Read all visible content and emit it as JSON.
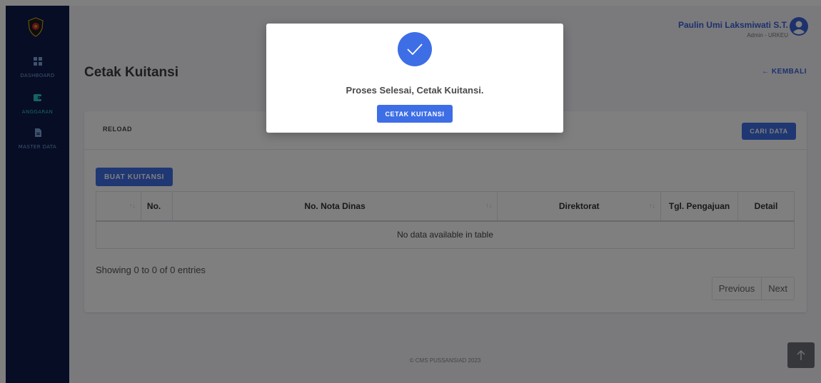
{
  "header": {
    "user_name": "Paulin Umi Laksmiwati S.T.",
    "user_role": "Admin - URKEU"
  },
  "sidebar": {
    "items": [
      {
        "label": "DASHBOARD",
        "icon": "dashboard-icon",
        "active": false
      },
      {
        "label": "ANGGARAN",
        "icon": "wallet-icon",
        "active": true
      },
      {
        "label": "MASTER DATA",
        "icon": "document-icon",
        "active": false
      }
    ]
  },
  "page": {
    "title": "Cetak Kuitansi",
    "back_label": "← KEMBALI"
  },
  "card": {
    "reload_label": "RELOAD",
    "search_label": "CARI DATA",
    "create_label": "BUAT KUITANSI",
    "columns": [
      "No.",
      "No. Nota Dinas",
      "Direktorat",
      "Tgl. Pengajuan",
      "Detail"
    ],
    "empty_text": "No data available in table",
    "info": "Showing 0 to 0 of 0 entries",
    "pagination": {
      "previous": "Previous",
      "next": "Next"
    }
  },
  "footer": {
    "text": "© CMS PUSSANSIAD 2023"
  },
  "modal": {
    "message": "Proses Selesai, Cetak Kuitansi.",
    "button_label": "CETAK KUITANSI"
  },
  "colors": {
    "primary": "#3e6ee6",
    "sidebar": "#0d1a4a",
    "accent_teal": "#2ec4c6"
  }
}
